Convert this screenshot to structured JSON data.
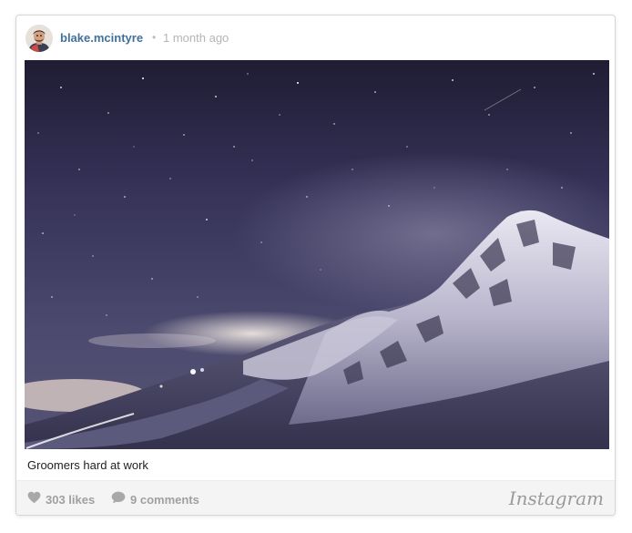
{
  "post": {
    "username": "blake.mcintyre",
    "separator": "•",
    "time": "1 month ago",
    "caption": "Groomers hard at work"
  },
  "stats": {
    "likes": "303 likes",
    "comments": "9 comments"
  },
  "brand": {
    "name": "Instagram"
  },
  "icons": {
    "likes": "heart-icon",
    "comments": "speech-bubble-icon"
  },
  "colors": {
    "username": "#3f729b",
    "muted": "#a0a0a0",
    "footer_bg": "#f4f4f4"
  }
}
